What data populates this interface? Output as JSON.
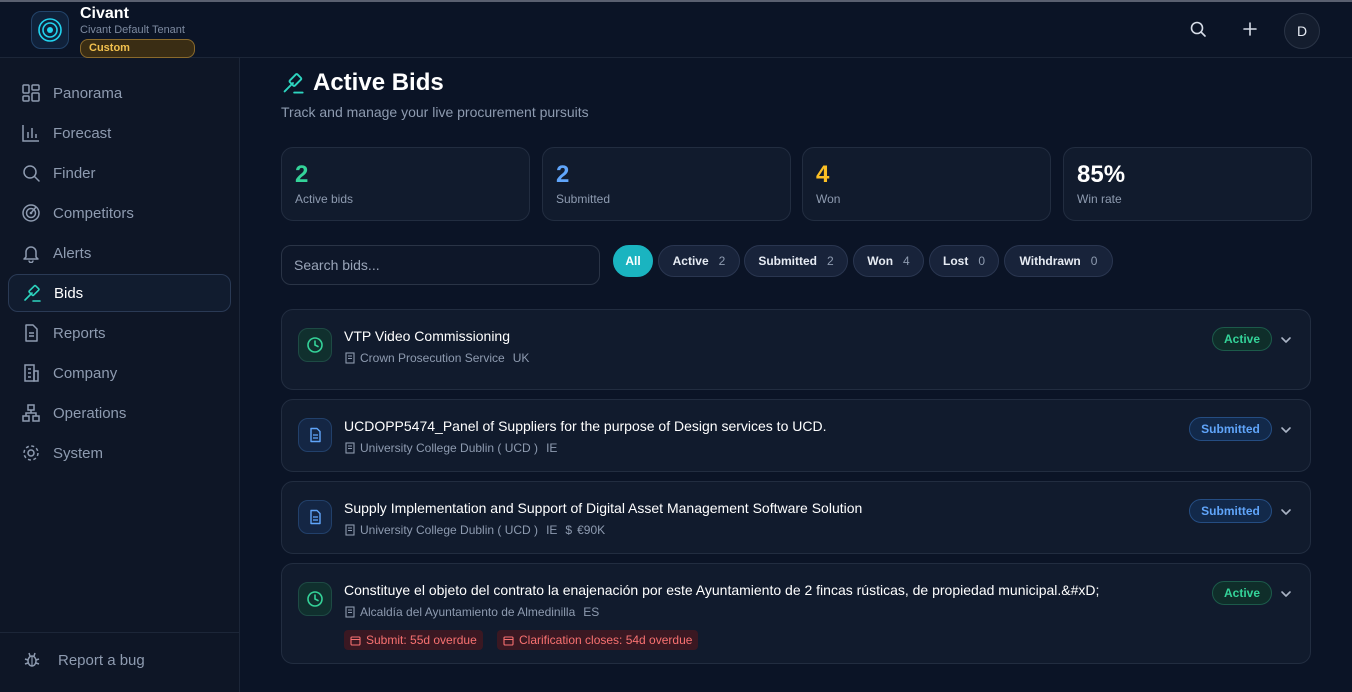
{
  "brand": {
    "name": "Civant",
    "tenant": "Civant Default Tenant",
    "badge": "Custom"
  },
  "topbar": {
    "icons": [
      "search-icon",
      "plus-icon"
    ],
    "avatar_initial": "D"
  },
  "sidebar": {
    "items": [
      {
        "label": "Panorama",
        "icon": "dashboard-icon"
      },
      {
        "label": "Forecast",
        "icon": "bar-chart-icon"
      },
      {
        "label": "Finder",
        "icon": "search-icon"
      },
      {
        "label": "Competitors",
        "icon": "radar-icon"
      },
      {
        "label": "Alerts",
        "icon": "bell-icon"
      },
      {
        "label": "Bids",
        "icon": "gavel-icon",
        "active": true
      },
      {
        "label": "Reports",
        "icon": "file-text-icon"
      },
      {
        "label": "Company",
        "icon": "building-icon"
      },
      {
        "label": "Operations",
        "icon": "network-icon"
      },
      {
        "label": "System",
        "icon": "gear-icon"
      }
    ],
    "report_bug": "Report a bug"
  },
  "page": {
    "title": "Active Bids",
    "subtitle": "Track and manage your live procurement pursuits"
  },
  "stats": [
    {
      "value": "2",
      "label": "Active bids",
      "color": "#34d399"
    },
    {
      "value": "2",
      "label": "Submitted",
      "color": "#60a5fa"
    },
    {
      "value": "4",
      "label": "Won",
      "color": "#fbbf24"
    },
    {
      "value": "85%",
      "label": "Win rate",
      "color": "#ffffff"
    }
  ],
  "search": {
    "placeholder": "Search bids..."
  },
  "filters": [
    {
      "label": "All",
      "count": "",
      "active": true
    },
    {
      "label": "Active",
      "count": "2"
    },
    {
      "label": "Submitted",
      "count": "2"
    },
    {
      "label": "Won",
      "count": "4"
    },
    {
      "label": "Lost",
      "count": "0"
    },
    {
      "label": "Withdrawn",
      "count": "0"
    }
  ],
  "bids": [
    {
      "title": "VTP Video Commissioning",
      "buyer": "Crown Prosecution Service",
      "country": "UK",
      "value": "",
      "status": "Active",
      "icon": "clock-icon"
    },
    {
      "title": "UCDOPP5474_Panel of Suppliers for the purpose of Design services to UCD.",
      "buyer": "University College Dublin ( UCD )",
      "country": "IE",
      "value": "",
      "status": "Submitted",
      "icon": "document-icon"
    },
    {
      "title": "Supply Implementation and Support of Digital Asset Management Software Solution",
      "buyer": "University College Dublin ( UCD )",
      "country": "IE",
      "value": "€90K",
      "status": "Submitted",
      "icon": "document-icon"
    },
    {
      "title": "Constituye el objeto del contrato la enajenación por este Ayuntamiento de 2 fincas rústicas, de propiedad municipal.&#xD;",
      "buyer": "Alcaldía del Ayuntamiento de Almedinilla",
      "country": "ES",
      "value": "",
      "status": "Active",
      "icon": "clock-icon",
      "deadlines": [
        "Submit: 55d overdue",
        "Clarification closes: 54d overdue"
      ]
    }
  ]
}
